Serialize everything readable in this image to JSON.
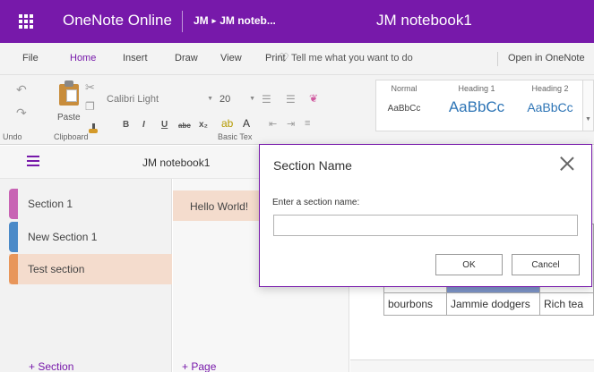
{
  "app": {
    "name": "OneNote Online",
    "breadcrumb": [
      "JM",
      "JM noteb..."
    ],
    "document_title": "JM notebook1"
  },
  "menu": {
    "tabs": [
      "File",
      "Home",
      "Insert",
      "Draw",
      "View",
      "Print"
    ],
    "active_tab": "Home",
    "tell_me": "Tell me what you want to do",
    "open_in": "Open in OneNote"
  },
  "ribbon": {
    "undo_group": "Undo",
    "clipboard_group": "Clipboard",
    "paste_label": "Paste",
    "basic_text_group": "Basic Tex",
    "font_name": "Calibri Light",
    "font_size": "20",
    "format_buttons": [
      "B",
      "I",
      "U",
      "abc",
      "x₂"
    ],
    "styles": [
      {
        "name": "Normal",
        "preview": "AaBbCc"
      },
      {
        "name": "Heading 1",
        "preview": "AaBbCc"
      },
      {
        "name": "Heading 2",
        "preview": "AaBbCc"
      }
    ]
  },
  "notebook": {
    "title": "JM notebook1",
    "sections": [
      {
        "label": "Section 1",
        "color": "#c864b4"
      },
      {
        "label": "New Section 1",
        "color": "#4b8ac8"
      },
      {
        "label": "Test section",
        "color": "#e8965a"
      }
    ],
    "active_section": "Test section",
    "add_section": "+ Section",
    "pages": [
      "Hello World!"
    ],
    "add_page": "+ Page"
  },
  "canvas": {
    "table": {
      "row1_partial": "c",
      "row3": [
        "bourbons",
        "Jammie dodgers",
        "Rich tea"
      ]
    }
  },
  "dialog": {
    "title": "Section Name",
    "label": "Enter a section name:",
    "input_value": "",
    "ok": "OK",
    "cancel": "Cancel"
  },
  "colors": {
    "brand": "#7719aa",
    "selected_bg": "#f4dccd",
    "table_highlight": "#7d93c8"
  }
}
